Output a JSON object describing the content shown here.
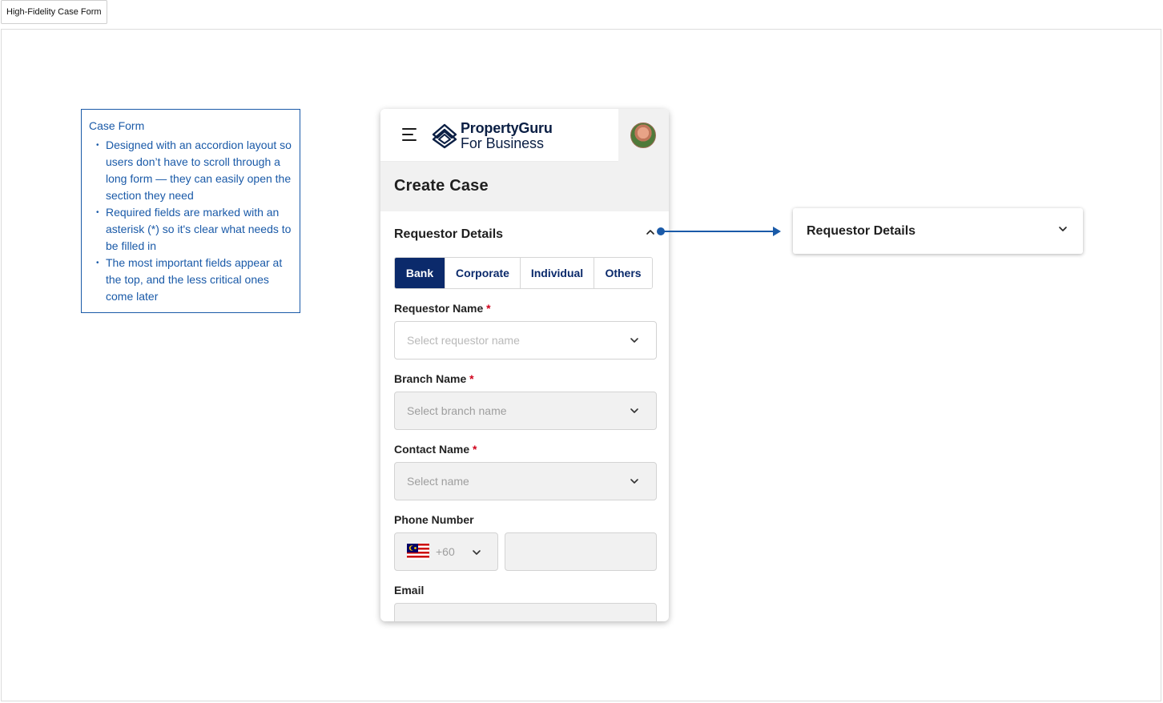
{
  "frame": {
    "tab_label": "High-Fidelity Case Form"
  },
  "note": {
    "title": "Case Form",
    "bullets": [
      "Designed with an accordion layout so users don’t have to scroll through a long form — they can easily open the section they need",
      "Required fields are marked with an asterisk (*) so it's clear what needs to be filled in",
      "The most important fields appear at the top, and the less critical ones come later"
    ]
  },
  "header": {
    "logo_line1": "PropertyGuru",
    "logo_line2": "For Business",
    "menu_icon": "hamburger-icon",
    "logo_icon": "propertyguru-logo-icon"
  },
  "page": {
    "title": "Create Case"
  },
  "section": {
    "title": "Requestor Details",
    "tabs": [
      {
        "label": "Bank",
        "active": true
      },
      {
        "label": "Corporate",
        "active": false
      },
      {
        "label": "Individual",
        "active": false
      },
      {
        "label": "Others",
        "active": false
      }
    ]
  },
  "form": {
    "required_mark": "*",
    "requestor_name": {
      "label": "Requestor Name",
      "placeholder": "Select requestor name"
    },
    "branch_name": {
      "label": "Branch Name",
      "placeholder": "Select branch name"
    },
    "contact_name": {
      "label": "Contact Name",
      "placeholder": "Select name"
    },
    "phone_number": {
      "label": "Phone Number",
      "country_code": "+60",
      "flag_icon": "malaysia-flag-icon"
    },
    "email": {
      "label": "Email"
    }
  },
  "collapsed_section": {
    "title": "Requestor Details"
  },
  "colors": {
    "brand_navy": "#0b2a6b",
    "annotation_blue": "#1a5aa8",
    "required_red": "#d0021b"
  }
}
